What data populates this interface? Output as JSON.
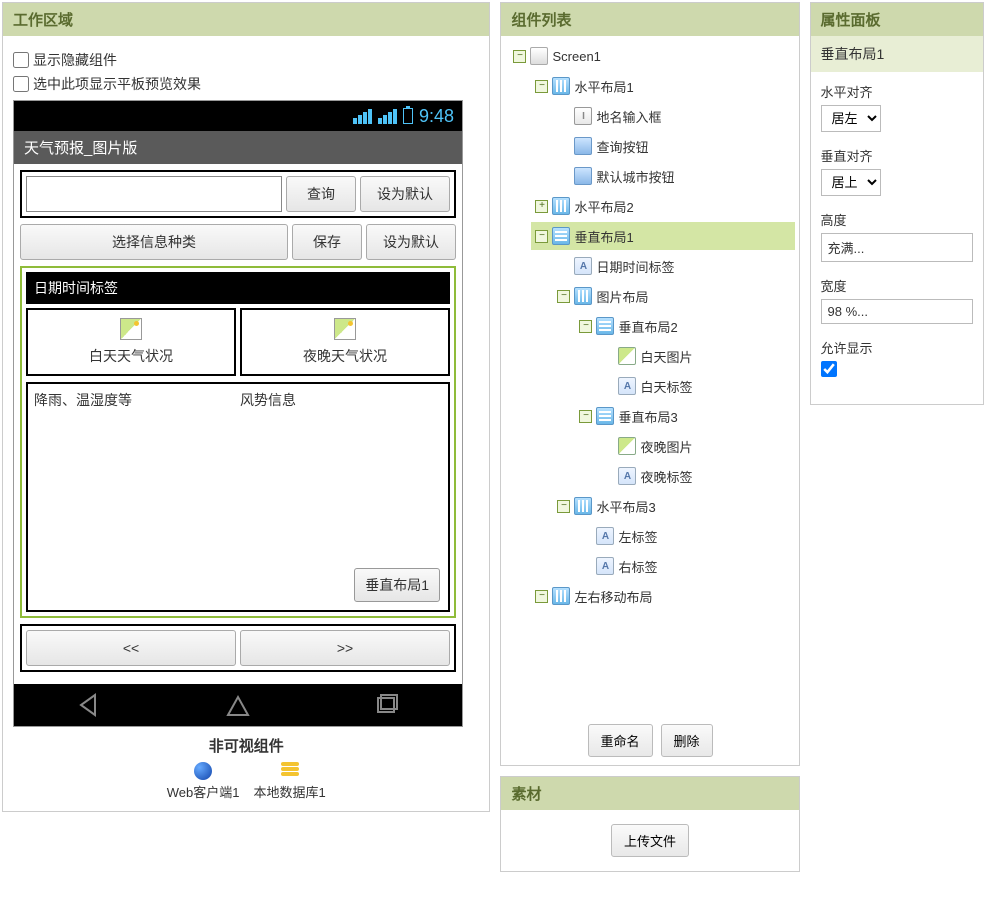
{
  "panels": {
    "work": "工作区域",
    "components": "组件列表",
    "properties": "属性面板",
    "assets": "素材"
  },
  "work": {
    "show_hidden": "显示隐藏组件",
    "tablet_preview": "选中此项显示平板预览效果",
    "clock": "9:48",
    "app_title": "天气预报_图片版",
    "btn_query": "查询",
    "btn_default1": "设为默认",
    "btn_select_kind": "选择信息种类",
    "btn_save": "保存",
    "btn_default2": "设为默认",
    "date_label": "日期时间标签",
    "day_weather": "白天天气状况",
    "night_weather": "夜晚天气状况",
    "rain_info": "降雨、温湿度等",
    "wind_info": "风势信息",
    "sel_tag": "垂直布局1",
    "prev": "<<",
    "next": ">>",
    "nonvis_title": "非可视组件",
    "nv_web": "Web客户端1",
    "nv_db": "本地数据库1"
  },
  "tree": {
    "screen": "Screen1",
    "h1": "水平布局1",
    "place_input": "地名输入框",
    "query_btn": "查询按钮",
    "default_btn": "默认城市按钮",
    "h2": "水平布局2",
    "v1": "垂直布局1",
    "date_lbl": "日期时间标签",
    "img_layout": "图片布局",
    "v2": "垂直布局2",
    "day_img": "白天图片",
    "day_lbl": "白天标签",
    "v3": "垂直布局3",
    "night_img": "夜晚图片",
    "night_lbl": "夜晚标签",
    "h3": "水平布局3",
    "left_lbl": "左标签",
    "right_lbl": "右标签",
    "lr_layout": "左右移动布局",
    "rename": "重命名",
    "delete": "删除"
  },
  "assets": {
    "upload": "上传文件"
  },
  "props": {
    "selected": "垂直布局1",
    "halign_lbl": "水平对齐",
    "halign_val": "居左",
    "valign_lbl": "垂直对齐",
    "valign_val": "居上",
    "height_lbl": "高度",
    "height_val": "充满...",
    "width_lbl": "宽度",
    "width_val": "98 %...",
    "visible_lbl": "允许显示"
  }
}
